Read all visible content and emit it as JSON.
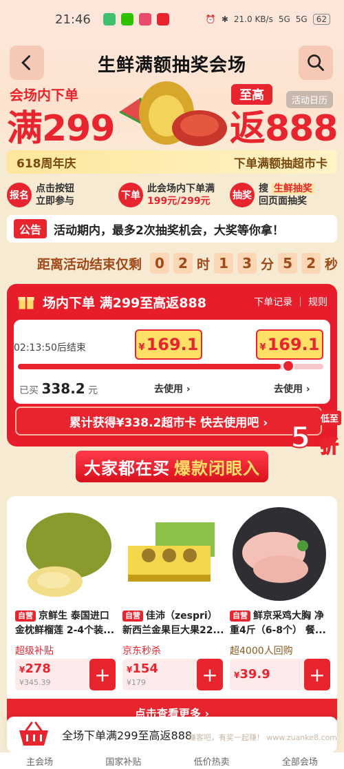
{
  "status_bar": {
    "time": "21:46",
    "network": "21.0 KB/s",
    "signal_left": "5G",
    "signal_right": "5G",
    "battery": "62"
  },
  "header": {
    "title": "生鲜满额抽奖会场"
  },
  "hero": {
    "left_line1": "会场内下单",
    "left_line2": "满299",
    "right_line1": "至高",
    "right_line2": "返888",
    "calendar_button": "活动日历"
  },
  "banner_618": {
    "left": "618周年庆",
    "right": "下单满额抽超市卡"
  },
  "steps": [
    {
      "badge": "报名",
      "line1": "点击按钮",
      "line2": "立即参与"
    },
    {
      "badge": "下单",
      "line1": "此会场内下单满",
      "line2": "199元/299元"
    },
    {
      "badge": "抽奖",
      "line1_prefix": "搜",
      "line1_highlight": "生鲜抽奖",
      "line2": "回页面抽奖"
    }
  ],
  "notice": {
    "tag": "公告",
    "text": "活动期内，最多2次抽奖机会，大奖等你拿！"
  },
  "countdown": {
    "label": "距离活动结束仅剩",
    "h1": "0",
    "h2": "2",
    "hour_unit": "时",
    "m1": "1",
    "m2": "3",
    "minute_unit": "分",
    "s1": "5",
    "s2": "2",
    "second_unit": "秒"
  },
  "rebate_card": {
    "title": "场内下单 满299至高返888",
    "links": "下单记录 ｜ 规则",
    "ends_in": "02:13:50后结束",
    "coupon_symbol": "¥",
    "coupon_1": "169.1",
    "coupon_2": "169.1",
    "progress_fraction": 0.86,
    "bought_label": "已买",
    "bought_amount": "338.2",
    "bought_unit": "元",
    "use_1": "去使用 ›",
    "use_2": "去使用 ›",
    "cta": "累计获得¥338.2超市卡 快去使用吧 ›"
  },
  "discount_badge": {
    "low": "低至",
    "value": "5",
    "unit": "折"
  },
  "section": {
    "title_white": "大家都在买",
    "title_yellow": "爆款闭眼入"
  },
  "products": [
    {
      "tag": "自营",
      "name": "京鲜生 泰国进口金枕鲜榴莲 2-4个装...",
      "sub": "超级补贴",
      "currency": "¥",
      "price": "278",
      "old_price": "¥345.39"
    },
    {
      "tag": "自营",
      "name": "佳沛（zespri）新西兰金果巨大果22...",
      "sub": "京东秒杀",
      "currency": "¥",
      "price": "154",
      "old_price": "¥179"
    },
    {
      "tag": "自营",
      "name": "鲜京采鸡大胸 净重4斤（6-8个） 餐...",
      "sub": "超4000人回购",
      "currency": "¥",
      "price": "39.9",
      "old_price": ""
    }
  ],
  "more_bar": "点击查看更多 ›",
  "popup": {
    "text": "全场下单满299至高返888"
  },
  "watermark": "赚客吧，有奖一起赚！ www.zuanke8.com",
  "tabbar": [
    "主会场",
    "国家补贴",
    "低价热卖",
    "全部会场"
  ],
  "colors": {
    "primary_red": "#e8242f",
    "coupon_yellow": "#ffe067",
    "bg": "#f6ead2"
  }
}
